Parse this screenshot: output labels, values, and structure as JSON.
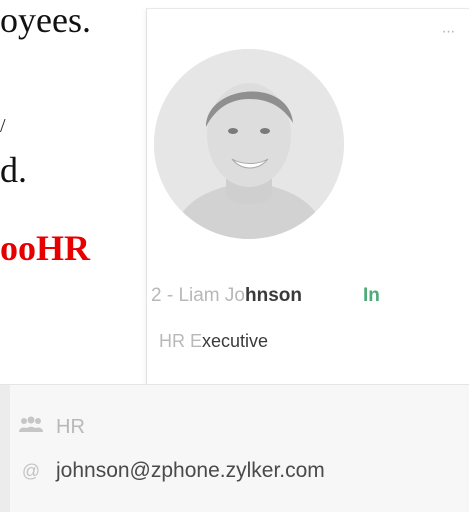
{
  "background_document": {
    "line1": "oyees.",
    "line2": "/",
    "line3": "d.",
    "line4": "ooHR"
  },
  "profile_card": {
    "more_label": "···",
    "name_prefix": "2 - Liam Jo",
    "name_bold": "hnson",
    "status": "In",
    "designation_prefix": "HR E",
    "designation_suffix": "xecutive",
    "department": "HR",
    "email": "johnson@zphone.zylker.com"
  },
  "icons": {
    "more": "more-options-icon",
    "department": "department-icon",
    "email": "at-sign-icon"
  }
}
